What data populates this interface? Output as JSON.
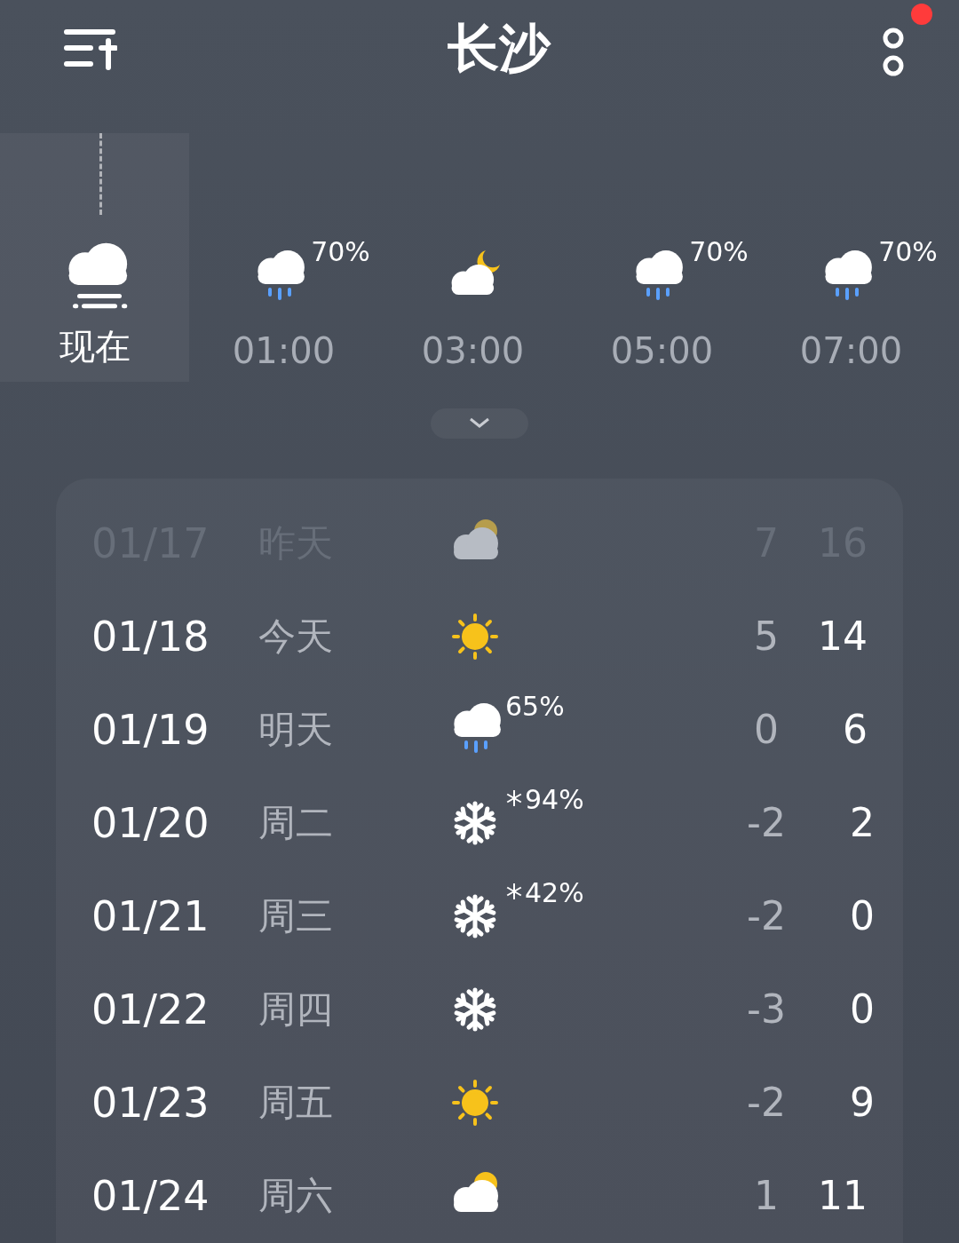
{
  "header": {
    "title": "长沙",
    "notification_dot": true
  },
  "hourly": [
    {
      "time": "现在",
      "kind": "haze",
      "selected": true
    },
    {
      "time": "01:00",
      "kind": "rain",
      "pop": "70%",
      "selected": false
    },
    {
      "time": "03:00",
      "kind": "night",
      "selected": false
    },
    {
      "time": "05:00",
      "kind": "rain",
      "pop": "70%",
      "selected": false
    },
    {
      "time": "07:00",
      "kind": "rain",
      "pop": "70%",
      "selected": false
    }
  ],
  "daily": [
    {
      "date": "01/17",
      "day": "昨天",
      "kind": "partly",
      "low": "7",
      "high": "16",
      "past": true
    },
    {
      "date": "01/18",
      "day": "今天",
      "kind": "clear",
      "low": "5",
      "high": "14",
      "past": false
    },
    {
      "date": "01/19",
      "day": "明天",
      "kind": "rain",
      "pop": "65%",
      "low": "0",
      "high": "6",
      "past": false
    },
    {
      "date": "01/20",
      "day": "周二",
      "kind": "snow",
      "pop": "94%",
      "low": "-2",
      "high": "2",
      "past": false
    },
    {
      "date": "01/21",
      "day": "周三",
      "kind": "snow",
      "pop": "42%",
      "low": "-2",
      "high": "0",
      "past": false
    },
    {
      "date": "01/22",
      "day": "周四",
      "kind": "snow",
      "low": "-3",
      "high": "0",
      "past": false
    },
    {
      "date": "01/23",
      "day": "周五",
      "kind": "clear",
      "low": "-2",
      "high": "9",
      "past": false
    },
    {
      "date": "01/24",
      "day": "周六",
      "kind": "partly",
      "low": "1",
      "high": "11",
      "past": false
    }
  ]
}
